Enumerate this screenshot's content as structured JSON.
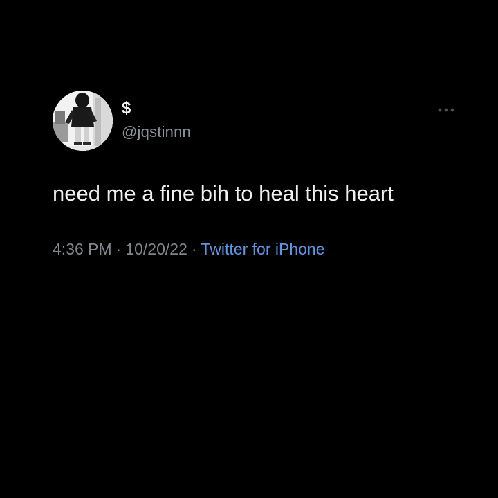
{
  "tweet": {
    "display_name": "$",
    "handle": "@jqstinnn",
    "text": "need me a fine bih to heal this heart",
    "time": "4:36 PM",
    "separator": "·",
    "date": "10/20/22",
    "source": "Twitter for iPhone"
  },
  "icons": {
    "avatar": "profile-photo",
    "more": "more-horizontal-icon"
  },
  "colors": {
    "background": "#000000",
    "text": "#eef0f1",
    "secondary_text": "#80868d",
    "link": "#5a95e6"
  }
}
